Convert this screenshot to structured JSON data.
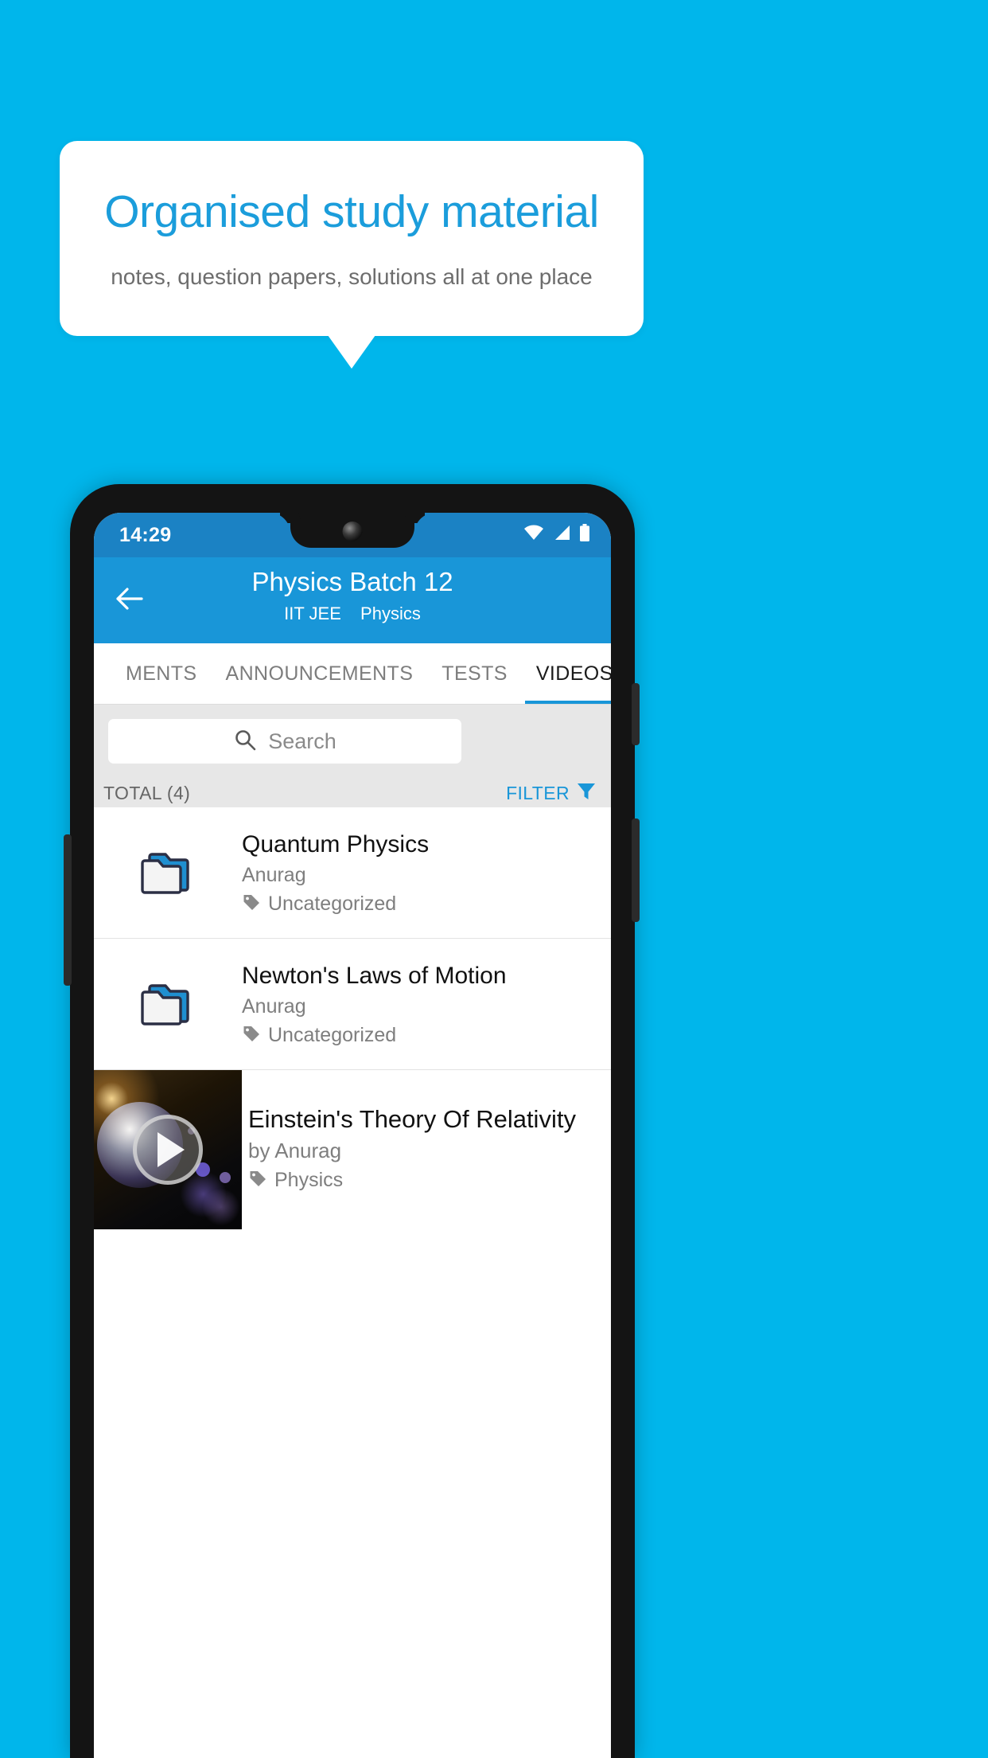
{
  "promo": {
    "title": "Organised study material",
    "subtitle": "notes, question papers, solutions all at one place"
  },
  "colors": {
    "background": "#00b6eb",
    "accent": "#1996d8",
    "statusbar": "#1b82c4",
    "promo_title": "#1b9ddb",
    "tab_active_text": "#1b1b1b",
    "tab_inactive_text": "#7d7d7d",
    "search_zone": "#e7e7e7"
  },
  "phone": {
    "statusbar": {
      "time": "14:29",
      "icons": [
        "wifi-icon",
        "signal-icon",
        "battery-icon"
      ]
    },
    "appbar": {
      "back_icon": "back-arrow-icon",
      "title": "Physics Batch 12",
      "exam": "IIT JEE",
      "subject": "Physics"
    },
    "tabs": [
      {
        "label": "MENTS",
        "active": false
      },
      {
        "label": "ANNOUNCEMENTS",
        "active": false
      },
      {
        "label": "TESTS",
        "active": false
      },
      {
        "label": "VIDEOS",
        "active": true
      }
    ],
    "search": {
      "icon": "search-icon",
      "placeholder": "Search",
      "value": ""
    },
    "toolbar": {
      "total_label": "TOTAL (4)",
      "filter_label": "FILTER",
      "filter_icon": "filter-funnel-icon"
    },
    "list": [
      {
        "type": "folder",
        "icon": "folder-icon",
        "title": "Quantum Physics",
        "author": "Anurag",
        "tag_icon": "tag-icon",
        "tag": "Uncategorized"
      },
      {
        "type": "folder",
        "icon": "folder-icon",
        "title": "Newton's Laws of Motion",
        "author": "Anurag",
        "tag_icon": "tag-icon",
        "tag": "Uncategorized"
      },
      {
        "type": "video",
        "icon": "play-icon",
        "title": "Einstein's Theory Of Relativity",
        "author": "by Anurag",
        "tag_icon": "tag-icon",
        "tag": "Physics"
      }
    ]
  }
}
